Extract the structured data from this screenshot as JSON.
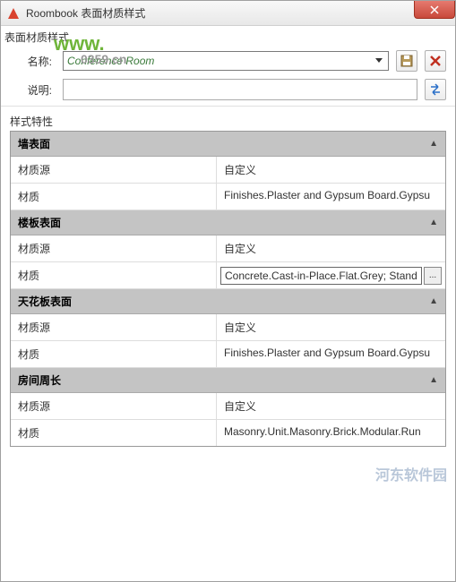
{
  "window": {
    "title": "Roombook 表面材质样式"
  },
  "toolbar": {
    "header": "表面材质样式"
  },
  "form": {
    "name_label": "名称:",
    "name_value": "Conference Room",
    "desc_label": "说明:",
    "desc_value": ""
  },
  "section": {
    "title": "样式特性"
  },
  "props": {
    "key_source": "材质源",
    "key_material": "材质",
    "val_custom": "自定义"
  },
  "groups": [
    {
      "title": "墙表面",
      "rows": [
        {
          "key": "材质源",
          "val": "自定义"
        },
        {
          "key": "材质",
          "val": "Finishes.Plaster and Gypsum Board.Gypsu"
        }
      ]
    },
    {
      "title": "楼板表面",
      "rows": [
        {
          "key": "材质源",
          "val": "自定义"
        },
        {
          "key": "材质",
          "val": "Concrete.Cast-in-Place.Flat.Grey; Stand",
          "editing": true
        }
      ]
    },
    {
      "title": "天花板表面",
      "rows": [
        {
          "key": "材质源",
          "val": "自定义"
        },
        {
          "key": "材质",
          "val": "Finishes.Plaster and Gypsum Board.Gypsu"
        }
      ]
    },
    {
      "title": "房间周长",
      "rows": [
        {
          "key": "材质源",
          "val": "自定义"
        },
        {
          "key": "材质",
          "val": "Masonry.Unit.Masonry.Brick.Modular.Run"
        }
      ]
    }
  ],
  "watermark": {
    "main": "www.",
    "domain": "0359.cn",
    "br": "河东软件园"
  }
}
